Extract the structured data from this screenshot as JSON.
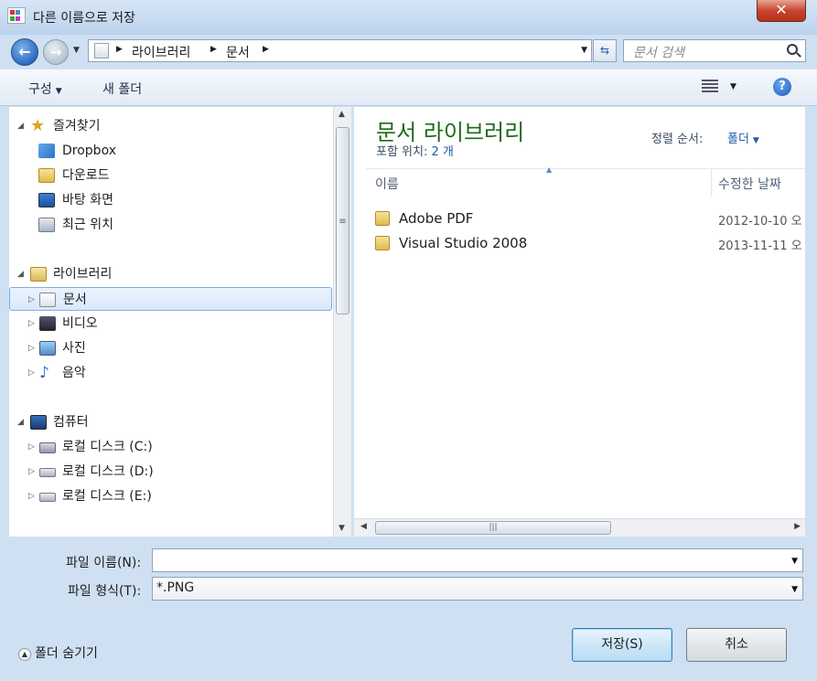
{
  "window": {
    "title": "다른 이름으로 저장",
    "close_label": "✕"
  },
  "nav": {
    "breadcrumb": [
      "라이브러리",
      "문서"
    ],
    "search_placeholder": "문서 검색"
  },
  "toolbar": {
    "organize_label": "구성",
    "new_folder_label": "새 폴더",
    "help_label": "?"
  },
  "tree": {
    "favorites": {
      "label": "즐겨찾기",
      "items": [
        {
          "label": "Dropbox",
          "icon": "dropbox-icon"
        },
        {
          "label": "다운로드",
          "icon": "downloads-icon"
        },
        {
          "label": "바탕 화면",
          "icon": "desktop-icon"
        },
        {
          "label": "최근 위치",
          "icon": "recent-places-icon"
        }
      ]
    },
    "libraries": {
      "label": "라이브러리",
      "items": [
        {
          "label": "문서",
          "icon": "documents-icon",
          "selected": true
        },
        {
          "label": "비디오",
          "icon": "videos-icon"
        },
        {
          "label": "사진",
          "icon": "pictures-icon"
        },
        {
          "label": "음악",
          "icon": "music-icon"
        }
      ]
    },
    "computer": {
      "label": "컴퓨터",
      "items": [
        {
          "label": "로컬 디스크 (C:)",
          "icon": "drive-c-icon"
        },
        {
          "label": "로컬 디스크 (D:)",
          "icon": "drive-icon"
        },
        {
          "label": "로컬 디스크 (E:)",
          "icon": "drive-icon"
        }
      ]
    }
  },
  "content": {
    "title": "문서 라이브러리",
    "includes_label": "포함 위치:",
    "includes_value": "2 개",
    "sort_label": "정렬 순서:",
    "sort_value": "폴더",
    "columns": [
      "이름",
      "수정한 날짜"
    ],
    "files": [
      {
        "name": "Adobe PDF",
        "date": "2012-10-10 오"
      },
      {
        "name": "Visual Studio 2008",
        "date": "2013-11-11 오"
      }
    ]
  },
  "form": {
    "filename_label": "파일 이름(N):",
    "filename_value": "",
    "filetype_label": "파일 형식(T):",
    "filetype_value": "*.PNG"
  },
  "footer": {
    "hide_folders_label": "폴더 숨기기",
    "save_label": "저장(S)",
    "cancel_label": "취소"
  }
}
